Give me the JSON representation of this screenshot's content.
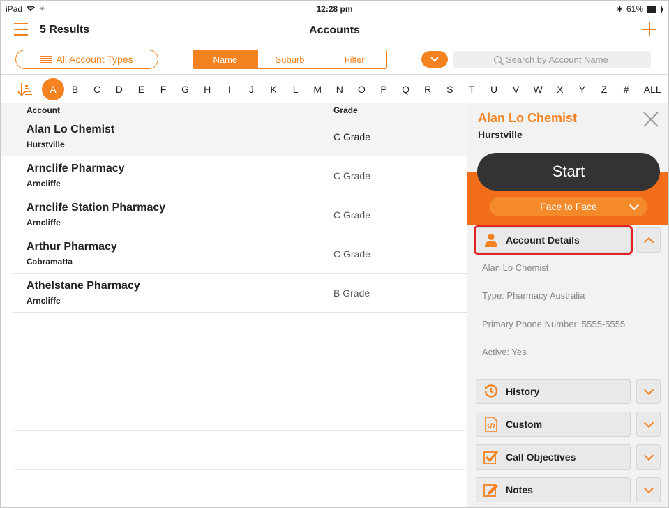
{
  "status": {
    "device": "iPad",
    "time": "12:28 pm",
    "battery_text": "61%",
    "battery_level": 0.61
  },
  "nav": {
    "results": "5 Results",
    "title": "Accounts"
  },
  "filters": {
    "account_types": "All Account Types",
    "segments": [
      "Name",
      "Suburb",
      "Filter"
    ],
    "active_segment": "Name",
    "search_placeholder": "Search by Account Name"
  },
  "alphabet": {
    "letters": [
      "A",
      "B",
      "C",
      "D",
      "E",
      "F",
      "G",
      "H",
      "I",
      "J",
      "K",
      "L",
      "M",
      "N",
      "O",
      "P",
      "Q",
      "R",
      "S",
      "T",
      "U",
      "V",
      "W",
      "X",
      "Y",
      "Z",
      "#",
      "ALL"
    ],
    "active": "A"
  },
  "table": {
    "headers": {
      "account": "Account",
      "grade": "Grade"
    },
    "rows": [
      {
        "name": "Alan Lo Chemist",
        "suburb": "Hurstville",
        "grade": "C Grade",
        "selected": true
      },
      {
        "name": "Arnclife Pharmacy",
        "suburb": "Arncliffe",
        "grade": "C Grade"
      },
      {
        "name": "Arnclife Station Pharmacy",
        "suburb": "Arncliffe",
        "grade": "C Grade"
      },
      {
        "name": "Arthur Pharmacy",
        "suburb": "Cabramatta",
        "grade": "C Grade"
      },
      {
        "name": "Athelstane Pharmacy",
        "suburb": "Arncliffe",
        "grade": "B Grade"
      }
    ]
  },
  "panel": {
    "title": "Alan Lo Chemist",
    "subtitle": "Hurstville",
    "start": "Start",
    "mode": "Face to Face",
    "account_details": {
      "label": "Account Details",
      "lines": [
        "Alan Lo Chemist",
        "Type: Pharmacy Australia",
        "Primary Phone Number: 5555-5555",
        "Active: Yes"
      ]
    },
    "sections": [
      {
        "label": "History",
        "icon": "history-icon"
      },
      {
        "label": "Custom",
        "icon": "code-file-icon"
      },
      {
        "label": "Call Objectives",
        "icon": "checkbox-icon"
      },
      {
        "label": "Notes",
        "icon": "edit-note-icon"
      }
    ]
  },
  "colors": {
    "accent": "#f58220",
    "band": "#f26e1b",
    "highlight": "#e22225"
  }
}
